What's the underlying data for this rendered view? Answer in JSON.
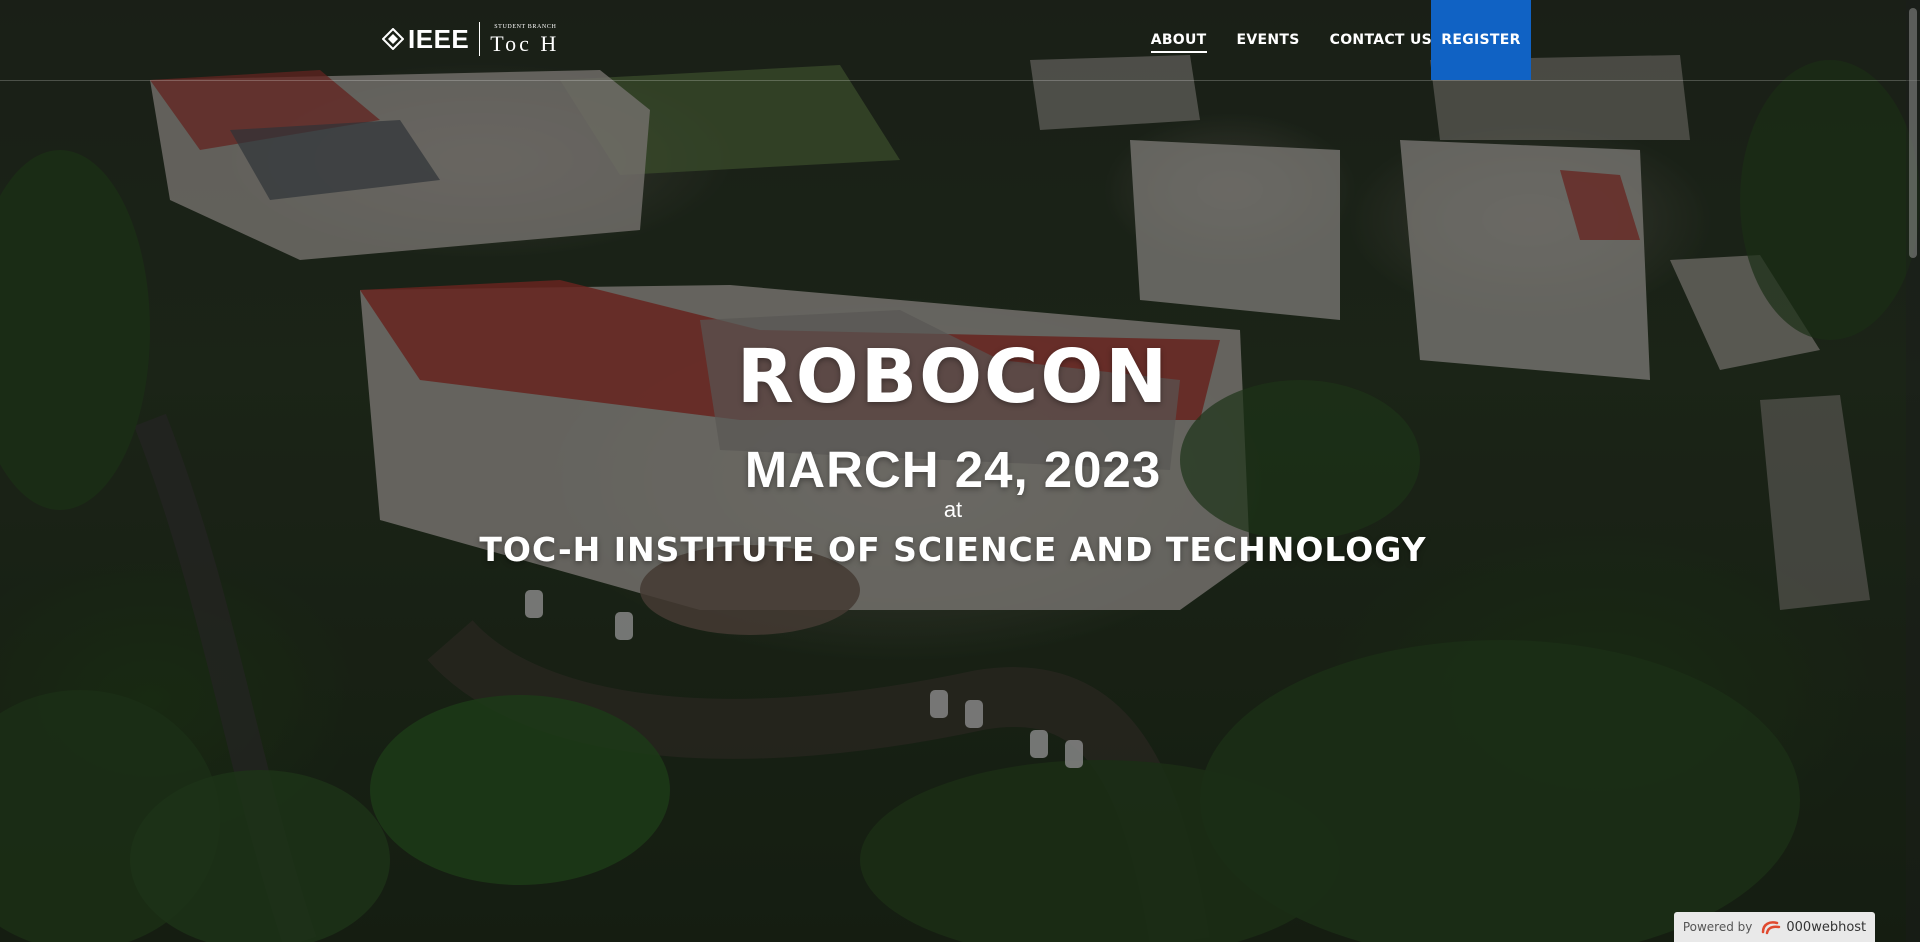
{
  "header": {
    "logo": {
      "brand": "IEEE",
      "sub_label": "STUDENT BRANCH",
      "name": "Toc H"
    },
    "nav": [
      {
        "label": "ABOUT",
        "active": true
      },
      {
        "label": "EVENTS",
        "active": false
      },
      {
        "label": "CONTACT US",
        "active": false
      }
    ],
    "register_label": "REGISTER",
    "accent_color": "#1062c4"
  },
  "hero": {
    "title": "ROBOCON",
    "date": "MARCH 24, 2023",
    "at": "at",
    "venue": "TOC-H INSTITUTE OF SCIENCE AND TECHNOLOGY",
    "background": "aerial-campus-photo"
  },
  "badge": {
    "prefix": "Powered by",
    "brand": "000webhost",
    "icon": "000webhost-logo-icon"
  }
}
